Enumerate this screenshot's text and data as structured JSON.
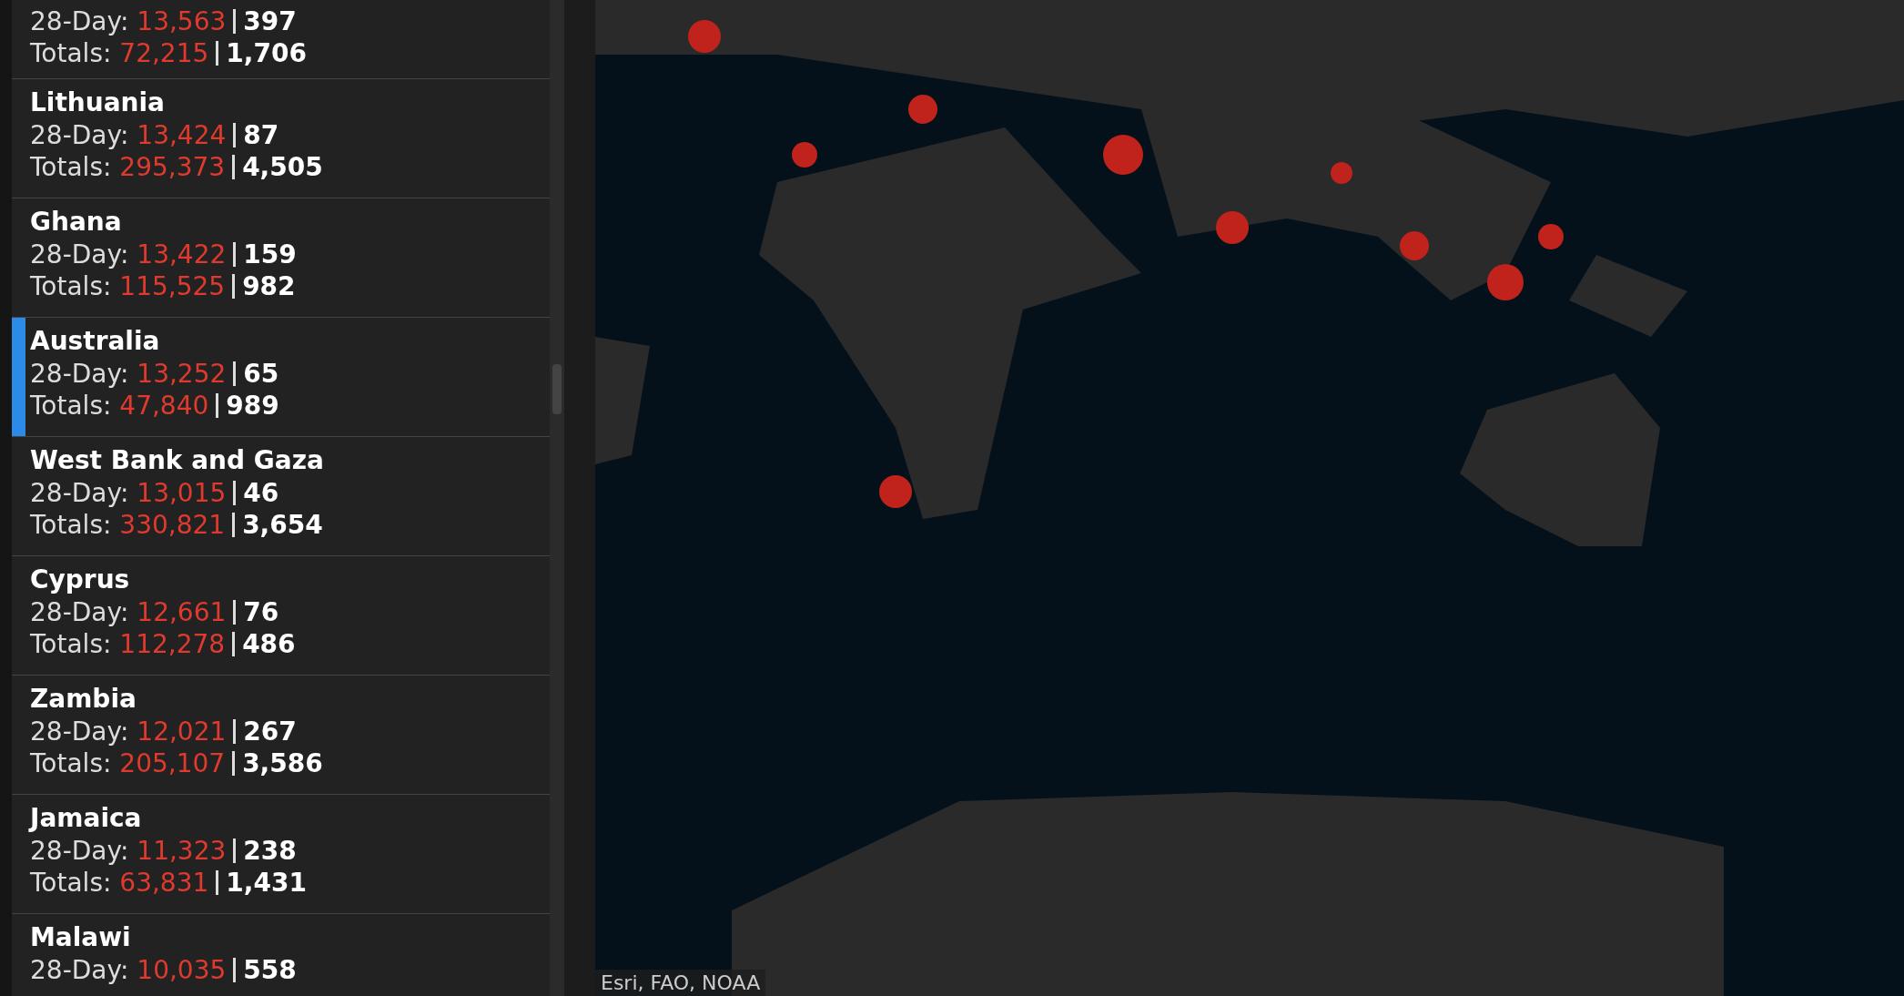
{
  "countries": [
    {
      "day28_cases": "13,563",
      "day28_deaths": "397",
      "total_cases": "72,215",
      "total_deaths": "1,706",
      "selected": false,
      "day_label": "28-Day:",
      "totals_label": "Totals:"
    },
    {
      "name": "Lithuania",
      "day_label": "28-Day:",
      "day28_cases": "13,424",
      "day28_deaths": "87",
      "totals_label": "Totals:",
      "total_cases": "295,373",
      "total_deaths": "4,505",
      "selected": false
    },
    {
      "name": "Ghana",
      "day_label": "28-Day:",
      "day28_cases": "13,422",
      "day28_deaths": "159",
      "totals_label": "Totals:",
      "total_cases": "115,525",
      "total_deaths": "982",
      "selected": false
    },
    {
      "name": "Australia",
      "day_label": "28-Day:",
      "day28_cases": "13,252",
      "day28_deaths": "65",
      "totals_label": "Totals:",
      "total_cases": "47,840",
      "total_deaths": "989",
      "selected": true
    },
    {
      "name": "West Bank and Gaza",
      "day_label": "28-Day:",
      "day28_cases": "13,015",
      "day28_deaths": "46",
      "totals_label": "Totals:",
      "total_cases": "330,821",
      "total_deaths": "3,654",
      "selected": false
    },
    {
      "name": "Cyprus",
      "day_label": "28-Day:",
      "day28_cases": "12,661",
      "day28_deaths": "76",
      "totals_label": "Totals:",
      "total_cases": "112,278",
      "total_deaths": "486",
      "selected": false
    },
    {
      "name": "Zambia",
      "day_label": "28-Day:",
      "day28_cases": "12,021",
      "day28_deaths": "267",
      "totals_label": "Totals:",
      "total_cases": "205,107",
      "total_deaths": "3,586",
      "selected": false
    },
    {
      "name": "Jamaica",
      "day_label": "28-Day:",
      "day28_cases": "11,323",
      "day28_deaths": "238",
      "totals_label": "Totals:",
      "total_cases": "63,831",
      "total_deaths": "1,431",
      "selected": false
    },
    {
      "name": "Malawi",
      "day_label": "28-Day:",
      "day28_cases": "10,035",
      "day28_deaths": "558",
      "selected": false
    }
  ],
  "map": {
    "kind": "picture",
    "attribution": "Esri, FAO, NOAA"
  }
}
